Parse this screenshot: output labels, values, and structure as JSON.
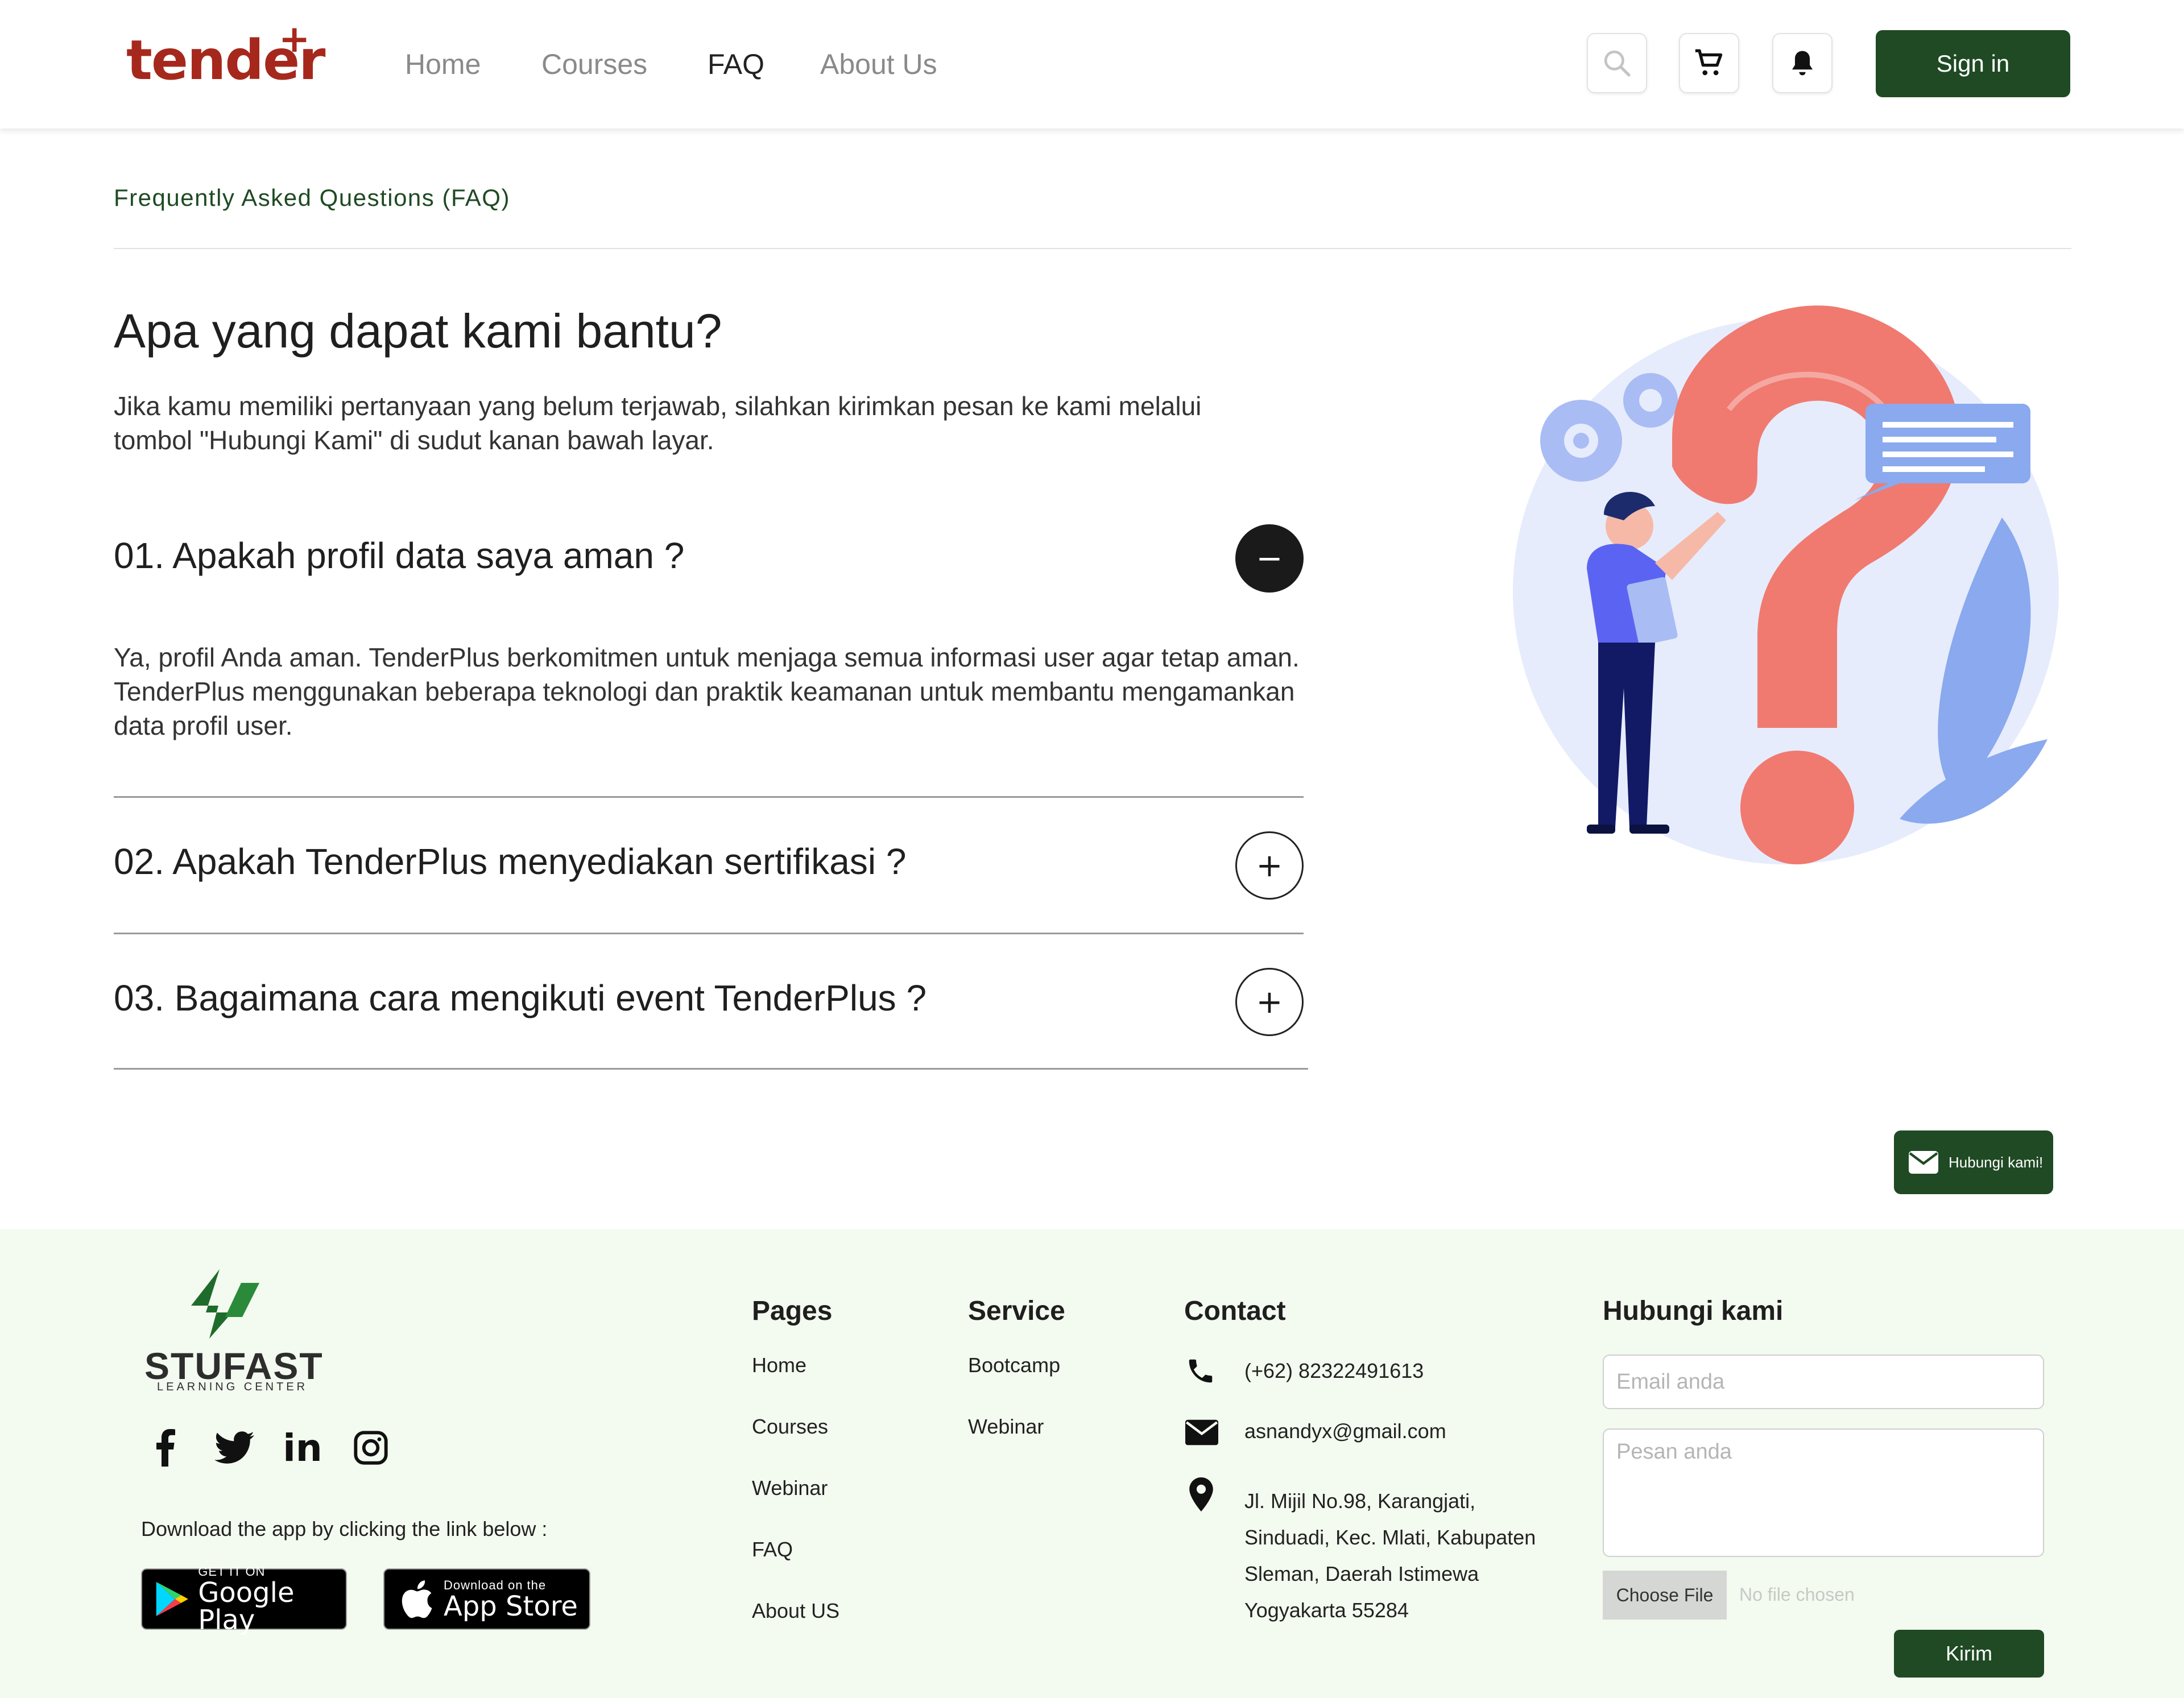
{
  "header": {
    "logo_text": "tender",
    "logo_plus": "+",
    "nav": [
      "Home",
      "Courses",
      "FAQ",
      "About Us"
    ],
    "active_nav": "FAQ",
    "icons": [
      "search-icon",
      "cart-icon",
      "bell-icon"
    ],
    "signin_label": "Sign in"
  },
  "page": {
    "breadcrumb": "Frequently Asked Questions (FAQ)",
    "title": "Apa yang dapat kami bantu?",
    "subtitle": "Jika kamu memiliki pertanyaan yang belum terjawab, silahkan kirimkan pesan ke kami melalui tombol \"Hubungi Kami\" di sudut kanan bawah layar."
  },
  "faq": [
    {
      "question": "01. Apakah profil data saya aman ?",
      "expanded": true,
      "toggle": "−",
      "answer": "Ya, profil Anda aman. TenderPlus berkomitmen untuk menjaga semua informasi user agar tetap aman. TenderPlus menggunakan beberapa teknologi dan praktik keamanan untuk membantu mengamankan data profil user."
    },
    {
      "question": "02. Apakah TenderPlus menyediakan sertifikasi ?",
      "expanded": false,
      "toggle": "+"
    },
    {
      "question": "03. Bagaimana cara mengikuti event TenderPlus ?",
      "expanded": false,
      "toggle": "+"
    }
  ],
  "floating_contact": {
    "label": "Hubungi kami!",
    "icon": "mail-icon"
  },
  "footer": {
    "brand_name": "STUFAST",
    "brand_tag": "LEARNING CENTER",
    "social": [
      "facebook-icon",
      "twitter-icon",
      "linkedin-icon",
      "instagram-icon"
    ],
    "download_text": "Download the app by clicking the link below :",
    "google_play": {
      "small": "GET IT ON",
      "big": "Google Play"
    },
    "app_store": {
      "small": "Download on the",
      "big": "App Store"
    },
    "pages": {
      "heading": "Pages",
      "links": [
        "Home",
        "Courses",
        "Webinar",
        "FAQ",
        "About US"
      ]
    },
    "service": {
      "heading": "Service",
      "links": [
        "Bootcamp",
        "Webinar"
      ]
    },
    "contact": {
      "heading": "Contact",
      "phone": "(+62) 82322491613",
      "email": "asnandyx@gmail.com",
      "address": [
        "Jl. Mijil No.98, Karangjati,",
        "Sinduadi, Kec. Mlati, Kabupaten",
        "Sleman, Daerah Istimewa",
        "Yogyakarta 55284"
      ]
    },
    "form": {
      "heading": "Hubungi kami",
      "email_placeholder": "Email anda",
      "message_placeholder": "Pesan anda",
      "choose_file": "Choose File",
      "no_file": "No file chosen",
      "submit": "Kirim"
    }
  },
  "colors": {
    "primary": "#1f4a24",
    "brand_red": "#a6281c",
    "footer_bg": "#f3faef",
    "accent_coral": "#f07a70",
    "accent_blue": "#8aa9ee"
  }
}
